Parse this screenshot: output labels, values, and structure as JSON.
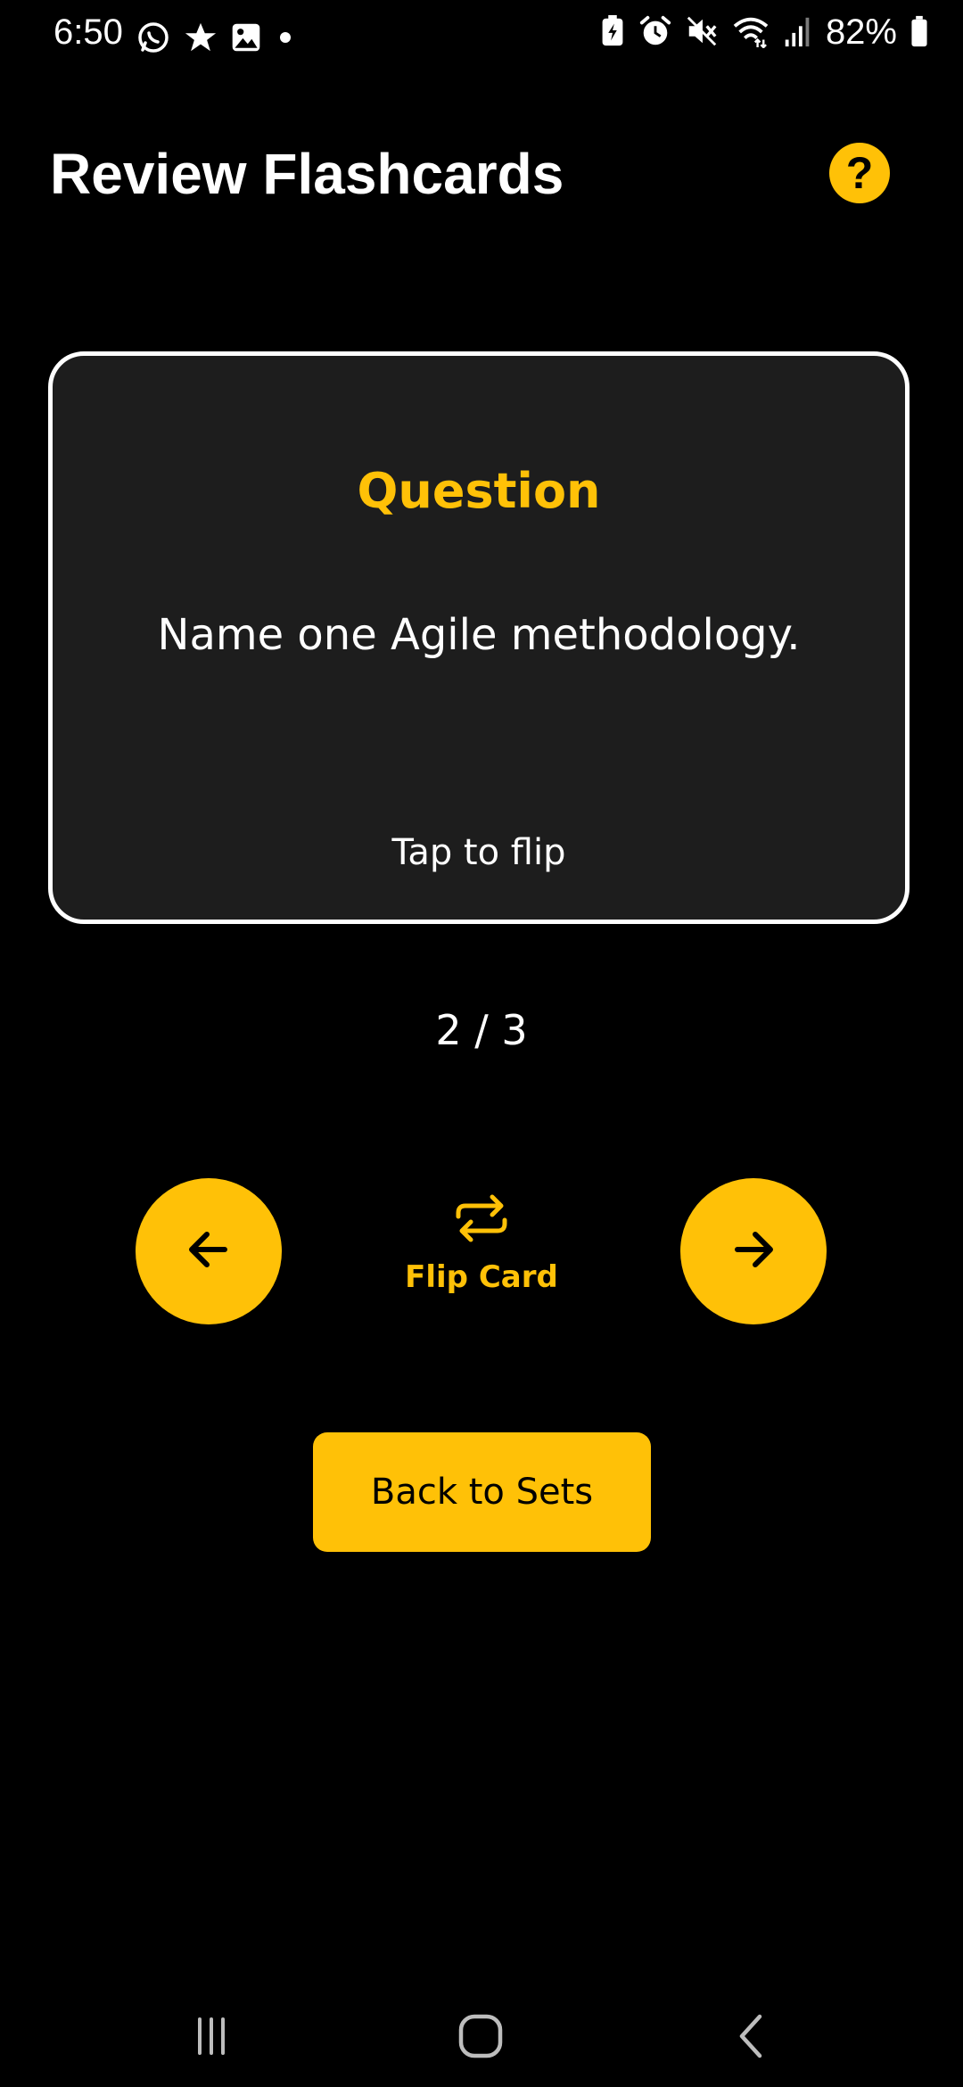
{
  "status_bar": {
    "time": "6:50",
    "battery": "82%",
    "left_icons": [
      "whatsapp-icon",
      "star-icon",
      "gallery-icon",
      "dot-icon"
    ],
    "right_icons": [
      "battery-saver-icon",
      "alarm-icon",
      "mute-icon",
      "wifi-icon",
      "signal-icon",
      "battery-icon"
    ]
  },
  "header": {
    "title": "Review Flashcards",
    "help_label": "?"
  },
  "card": {
    "side_label": "Question",
    "text": "Name one Agile methodology.",
    "hint": "Tap to flip"
  },
  "progress": {
    "current": 2,
    "total": 3,
    "label": "2 / 3"
  },
  "controls": {
    "prev_icon": "arrow-left-icon",
    "next_icon": "arrow-right-icon",
    "flip_icon": "repeat-icon",
    "flip_label": "Flip Card"
  },
  "footer": {
    "back_label": "Back to Sets"
  },
  "colors": {
    "background": "#000000",
    "card_background": "#1d1d1d",
    "accent": "#ffc107",
    "text": "#ffffff"
  }
}
